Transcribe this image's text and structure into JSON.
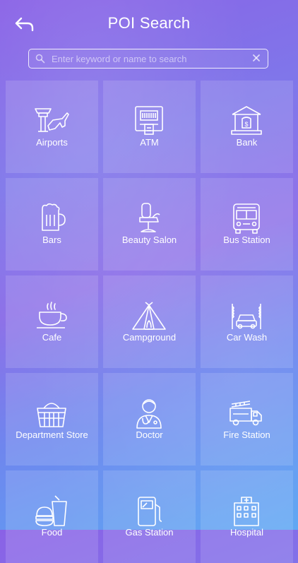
{
  "header": {
    "title": "POI Search",
    "back_icon": "back-arrow-icon"
  },
  "search": {
    "placeholder": "Enter keyword or name to search",
    "value": ""
  },
  "categories": [
    {
      "label": "Airports",
      "icon": "airport-icon"
    },
    {
      "label": "ATM",
      "icon": "atm-icon"
    },
    {
      "label": "Bank",
      "icon": "bank-icon"
    },
    {
      "label": "Bars",
      "icon": "beer-mug-icon"
    },
    {
      "label": "Beauty Salon",
      "icon": "salon-chair-icon"
    },
    {
      "label": "Bus Station",
      "icon": "bus-icon"
    },
    {
      "label": "Cafe",
      "icon": "coffee-cup-icon"
    },
    {
      "label": "Campground",
      "icon": "tent-icon"
    },
    {
      "label": "Car Wash",
      "icon": "car-wash-icon"
    },
    {
      "label": "Department Store",
      "icon": "shopping-basket-icon"
    },
    {
      "label": "Doctor",
      "icon": "doctor-icon"
    },
    {
      "label": "Fire Station",
      "icon": "fire-truck-icon"
    },
    {
      "label": "Food",
      "icon": "food-icon"
    },
    {
      "label": "Gas Station",
      "icon": "gas-pump-icon"
    },
    {
      "label": "Hospital",
      "icon": "hospital-icon"
    }
  ]
}
